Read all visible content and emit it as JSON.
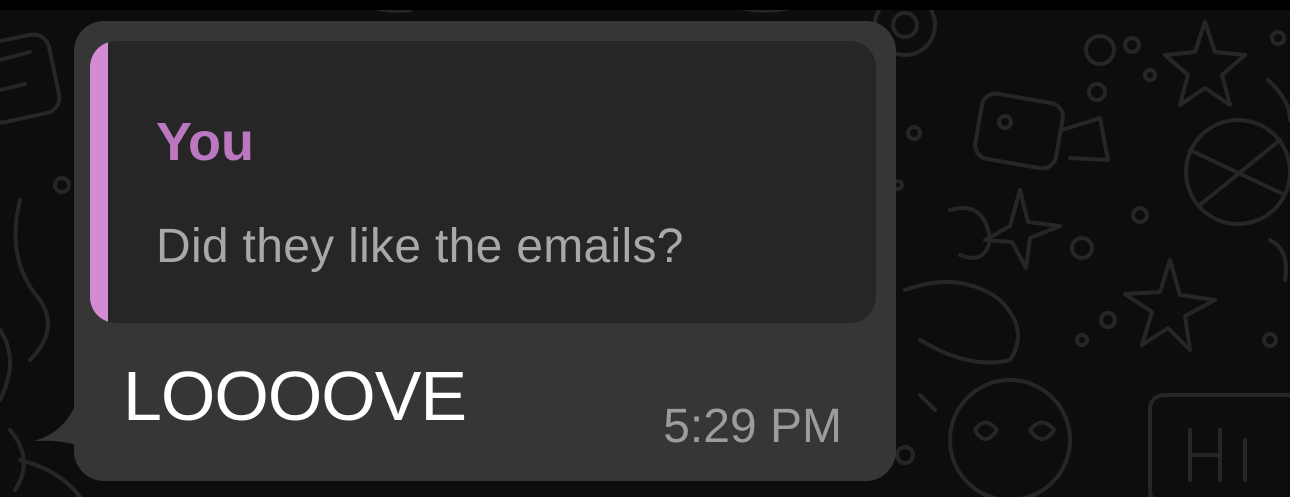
{
  "message": {
    "quoted": {
      "author": "You",
      "text": "Did they like the emails?",
      "accent_color": "#d38bd4"
    },
    "text": "LOOOOVE",
    "time": "5:29 PM",
    "bubble_color": "#363636"
  }
}
